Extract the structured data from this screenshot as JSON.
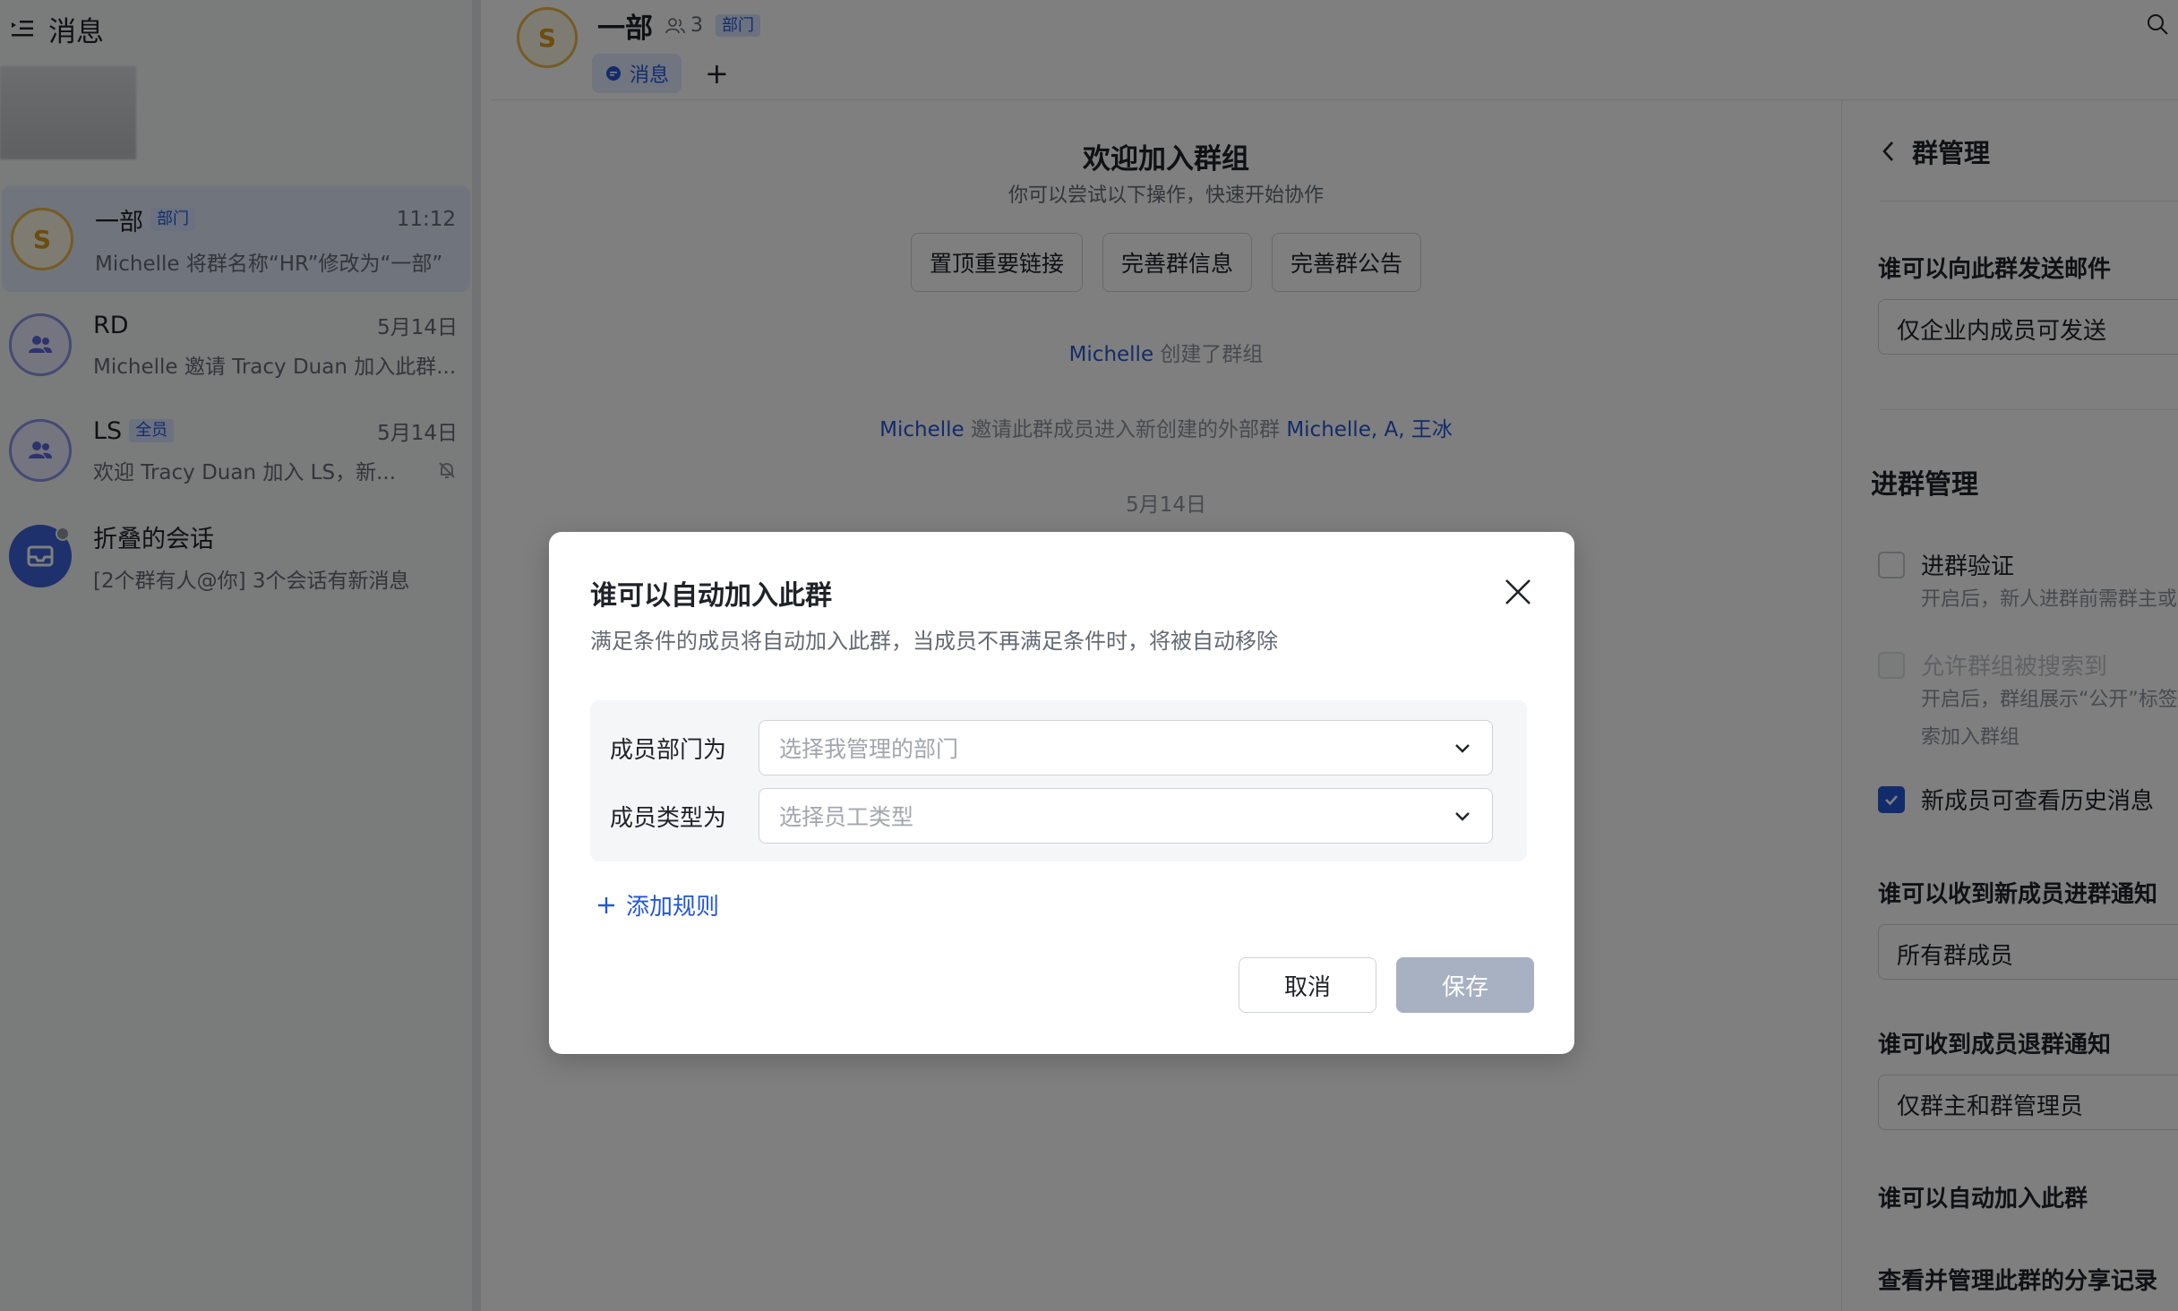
{
  "sidebar": {
    "title": "消息",
    "conversations": [
      {
        "name": "一部",
        "tag": "部门",
        "time": "11:12",
        "preview": "Michelle 将群名称“HR”修改为“一部”",
        "avatar": "S"
      },
      {
        "name": "RD",
        "tag": "",
        "time": "5月14日",
        "preview": "Michelle 邀请 Tracy Duan 加入此群..."
      },
      {
        "name": "LS",
        "tag": "全员",
        "time": "5月14日",
        "preview": "欢迎 Tracy Duan 加入 LS，新..."
      },
      {
        "name": "折叠的会话",
        "tag": "",
        "time": "",
        "preview": "[2个群有人@你] 3个会话有新消息"
      }
    ]
  },
  "chat": {
    "avatar": "S",
    "name": "一部",
    "member_count": "3",
    "tag": "部门",
    "tab_message": "消息",
    "add_tab": "+",
    "welcome_title": "欢迎加入群组",
    "welcome_sub": "你可以尝试以下操作，快速开始协作",
    "actions": [
      "置顶重要链接",
      "完善群信息",
      "完善群公告"
    ],
    "sys1_user": "Michelle",
    "sys1_text": " 创建了群组",
    "sys2_user": "Michelle",
    "sys2_text": " 邀请此群成员进入新创建的外部群 ",
    "sys2_targets": "Michelle, A, 王冰",
    "date": "5月14日"
  },
  "panel": {
    "title": "群管理",
    "email_label": "谁可以向此群发送邮件",
    "email_value": "仅企业内成员可发送",
    "join_section": "进群管理",
    "verify_label": "进群验证",
    "verify_hint": "开启后，新人进群前需群主或",
    "search_label": "允许群组被搜索到",
    "search_hint1": "开启后，群组展示“公开”标签",
    "search_hint2": "索加入群组",
    "history_label": "新成员可查看历史消息",
    "join_notice_label": "谁可以收到新成员进群通知",
    "join_notice_value": "所有群成员",
    "leave_notice_label": "谁可收到成员退群通知",
    "leave_notice_value": "仅群主和群管理员",
    "auto_join_label": "谁可以自动加入此群",
    "share_label": "查看并管理此群的分享记录"
  },
  "modal": {
    "title": "谁可以自动加入此群",
    "description": "满足条件的成员将自动加入此群，当成员不再满足条件时，将被自动移除",
    "rule1_label": "成员部门为",
    "rule1_placeholder": "选择我管理的部门",
    "rule2_label": "成员类型为",
    "rule2_placeholder": "选择员工类型",
    "add_rule": "添加规则",
    "cancel": "取消",
    "save": "保存"
  },
  "colors": {
    "accent": "#2456d6",
    "overlay": "rgba(0,0,0,0.5)",
    "save_disabled": "#a8b1c1"
  }
}
